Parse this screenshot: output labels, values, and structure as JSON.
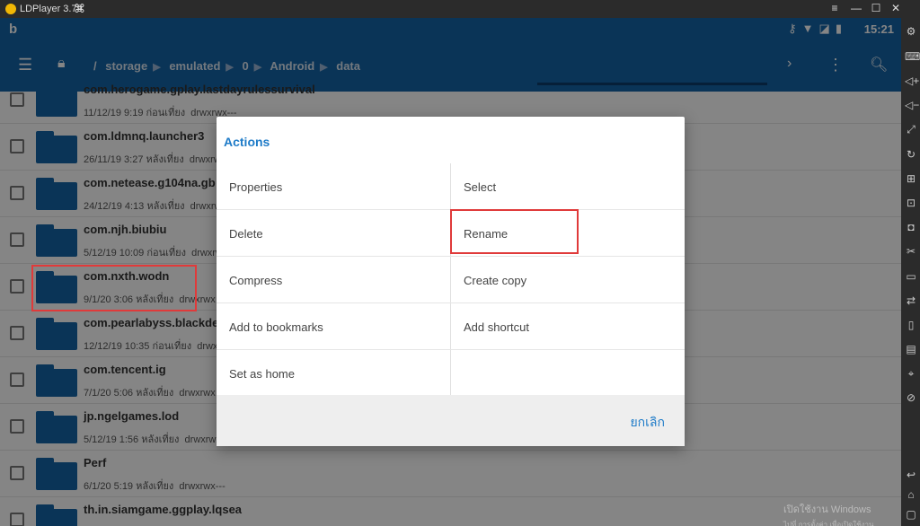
{
  "window": {
    "app_title": "LDPlayer 3.79",
    "controls": [
      "≡",
      "—",
      "☐",
      "✕"
    ]
  },
  "statusbar": {
    "time": "15:21"
  },
  "toolbar": {
    "breadcrumb": [
      "/",
      "storage",
      "emulated",
      "0",
      "Android",
      "data"
    ]
  },
  "files": [
    {
      "name": "com.herogame.gplay.lastdayrulessurvival",
      "date": "11/12/19 9:19 ก่อนเที่ยง",
      "perms": "drwxrwx---"
    },
    {
      "name": "com.ldmnq.launcher3",
      "date": "26/11/19 3:27 หลังเที่ยง",
      "perms": "drwxrwx"
    },
    {
      "name": "com.netease.g104na.gb",
      "date": "24/12/19 4:13 หลังเที่ยง",
      "perms": "drwxrwx"
    },
    {
      "name": "com.njh.biubiu",
      "date": "5/12/19 10:09 ก่อนเที่ยง",
      "perms": "drwxrwx"
    },
    {
      "name": "com.nxth.wodn",
      "date": "9/1/20 3:06 หลังเที่ยง",
      "perms": "drwxrwx"
    },
    {
      "name": "com.pearlabyss.blackdesert",
      "date": "12/12/19 10:35 ก่อนเที่ยง",
      "perms": "drwxrwx"
    },
    {
      "name": "com.tencent.ig",
      "date": "7/1/20 5:06 หลังเที่ยง",
      "perms": "drwxrwx"
    },
    {
      "name": "jp.ngelgames.lod",
      "date": "5/12/19 1:56 หลังเที่ยง",
      "perms": "drwxrwx"
    },
    {
      "name": "Perf",
      "date": "6/1/20 5:19 หลังเที่ยง",
      "perms": "drwxrwx---"
    },
    {
      "name": "th.in.siamgame.ggplay.lqsea",
      "date": "",
      "perms": ""
    }
  ],
  "dialog": {
    "title": "Actions",
    "actions": [
      [
        "Properties",
        "Select"
      ],
      [
        "Delete",
        "Rename"
      ],
      [
        "Compress",
        "Create copy"
      ],
      [
        "Add to bookmarks",
        "Add shortcut"
      ],
      [
        "Set as home",
        ""
      ]
    ],
    "cancel_label": "ยกเลิก"
  },
  "watermark": {
    "line1": "เปิดใช้งาน Windows",
    "line2": "ไปที่ การตั้งค่า เพื่อเปิดใช้งาน Windows"
  },
  "colors": {
    "accent": "#1565a8",
    "dialog_title": "#1e7bc8",
    "highlight": "#e03a3a"
  }
}
